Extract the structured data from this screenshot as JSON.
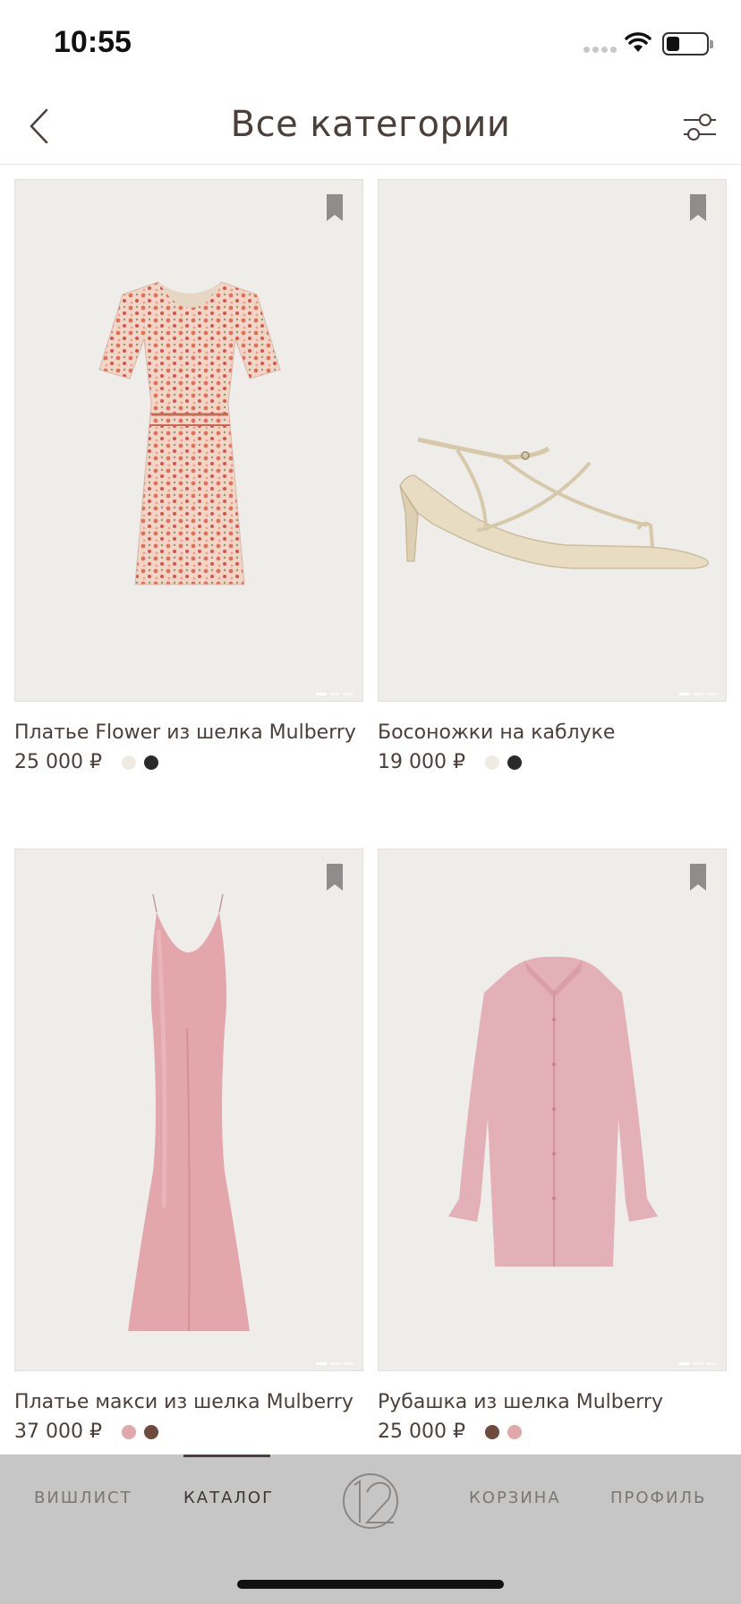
{
  "status_bar": {
    "time": "10:55",
    "icons": [
      "signal-dots-icon",
      "wifi-icon",
      "battery-icon"
    ]
  },
  "header": {
    "title": "Все категории",
    "back_icon": "chevron-left-icon",
    "filter_icon": "filter-sliders-icon"
  },
  "products": [
    {
      "name": "Платье Flower из шелка Mulberry",
      "price": "25 000 ₽",
      "colors": [
        "#efebe3",
        "#2a2a2a"
      ],
      "image": "floral-mini-dress"
    },
    {
      "name": "Босоножки на каблуке",
      "price": "19 000 ₽",
      "colors": [
        "#efebe3",
        "#2a2a2a"
      ],
      "image": "strappy-heeled-sandal"
    },
    {
      "name": "Платье макси из шелка Mulberry",
      "price": "37 000 ₽",
      "colors": [
        "#e0a8ab",
        "#6e4b3c"
      ],
      "image": "pink-slip-maxi-dress"
    },
    {
      "name": "Рубашка из шелка Mulberry",
      "price": "25 000 ₽",
      "colors": [
        "#6e4b3c",
        "#e0a8ab"
      ],
      "image": "pink-silk-shirt"
    }
  ],
  "tab_bar": {
    "wishlist": "ВИШЛИСТ",
    "catalog": "КАТАЛОГ",
    "cart": "КОРЗИНА",
    "profile": "ПРОФИЛЬ",
    "active": "catalog",
    "logo_icon": "brand-12-logo-icon"
  },
  "colors": {
    "text": "#4a3f3b",
    "card_bg": "#efedea",
    "tab_bar_bg": "#c6c6c6"
  }
}
